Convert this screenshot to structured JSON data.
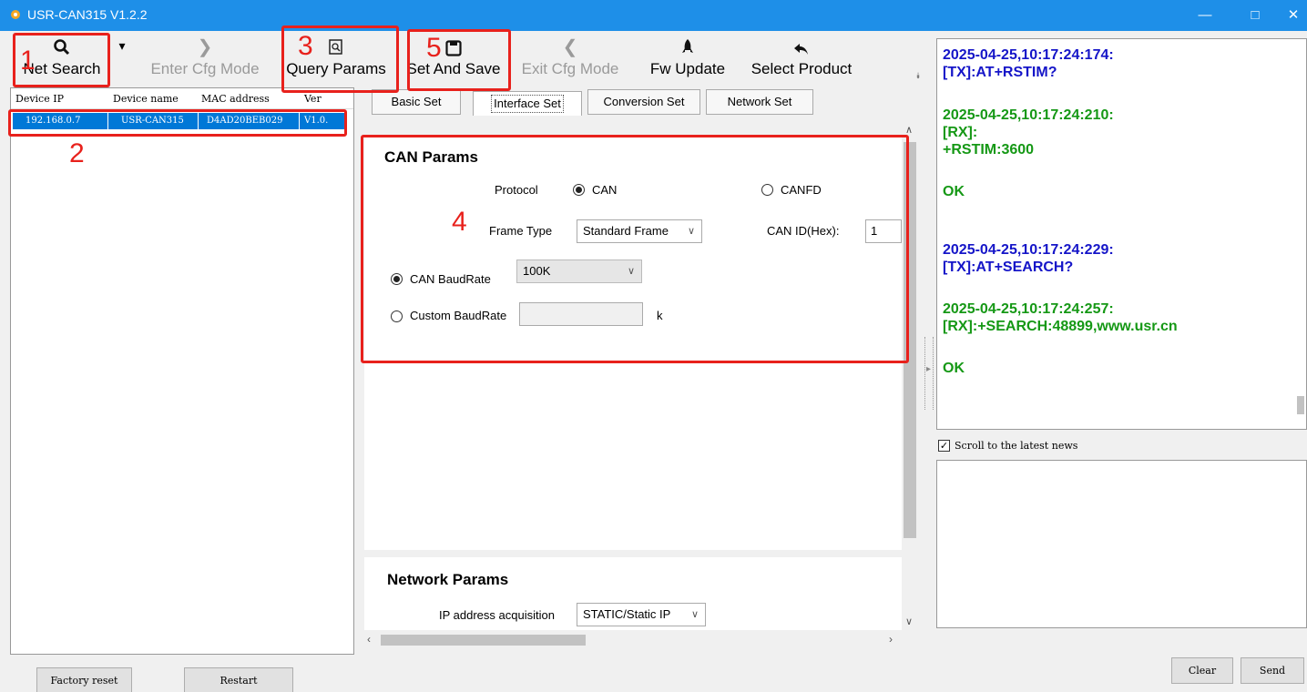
{
  "window": {
    "title": "USR-CAN315 V1.2.2",
    "minimize": "—",
    "maximize": "□",
    "close": "✕"
  },
  "toolbar": {
    "net_search": "Net Search",
    "enter_cfg": "Enter Cfg Mode",
    "query_params": "Query Params",
    "set_and_save": "Set And Save",
    "exit_cfg": "Exit Cfg Mode",
    "fw_update": "Fw Update",
    "select_product": "Select Product"
  },
  "device_table": {
    "columns": [
      "Device IP",
      "Device name",
      "MAC address",
      "Ver"
    ],
    "rows": [
      [
        "192.168.0.7",
        "USR-CAN315",
        "D4AD20BEB029",
        "V1.0."
      ]
    ]
  },
  "tabs": [
    "Basic Set",
    "Interface Set",
    "Conversion Set",
    "Network Set"
  ],
  "active_tab": "Interface Set",
  "can_params": {
    "title": "CAN Params",
    "protocol_label": "Protocol",
    "protocol_options": [
      "CAN",
      "CANFD"
    ],
    "protocol_selected": "CAN",
    "frame_type_label": "Frame Type",
    "frame_type_value": "Standard Frame",
    "can_id_label": "CAN ID(Hex):",
    "can_id_value": "1",
    "baud_label": "CAN BaudRate",
    "baud_value": "100K",
    "custom_baud_label": "Custom BaudRate",
    "custom_baud_value": "",
    "custom_baud_unit": "k"
  },
  "network_params": {
    "title": "Network Params",
    "ip_acq_label": "IP address acquisition",
    "ip_acq_value": "STATIC/Static IP"
  },
  "log": [
    {
      "ts": "2025-04-25,10:17:24:174:",
      "lines": [
        "[TX]:AT+RSTIM?"
      ],
      "dir": "tx"
    },
    {
      "ts": "2025-04-25,10:17:24:210:",
      "lines": [
        "[RX]:",
        "+RSTIM:3600",
        "",
        "OK"
      ],
      "dir": "rx"
    },
    {
      "ts": "2025-04-25,10:17:24:229:",
      "lines": [
        "[TX]:AT+SEARCH?"
      ],
      "dir": "tx"
    },
    {
      "ts": "2025-04-25,10:17:24:257:",
      "lines": [
        "[RX]:+SEARCH:48899,www.usr.cn",
        "",
        "OK"
      ],
      "dir": "rx"
    }
  ],
  "scroll_latest": {
    "label": "Scroll to the latest news",
    "checked": true
  },
  "buttons": {
    "factory_reset": "Factory reset",
    "restart": "Restart",
    "clear": "Clear",
    "send": "Send"
  },
  "annotations": [
    "1",
    "2",
    "3",
    "4",
    "5"
  ],
  "colors": {
    "titlebar": "#1e8fe8",
    "annotation": "#e8211c",
    "tx": "#1515c8",
    "rx": "#159815",
    "selection": "#0078d7"
  }
}
